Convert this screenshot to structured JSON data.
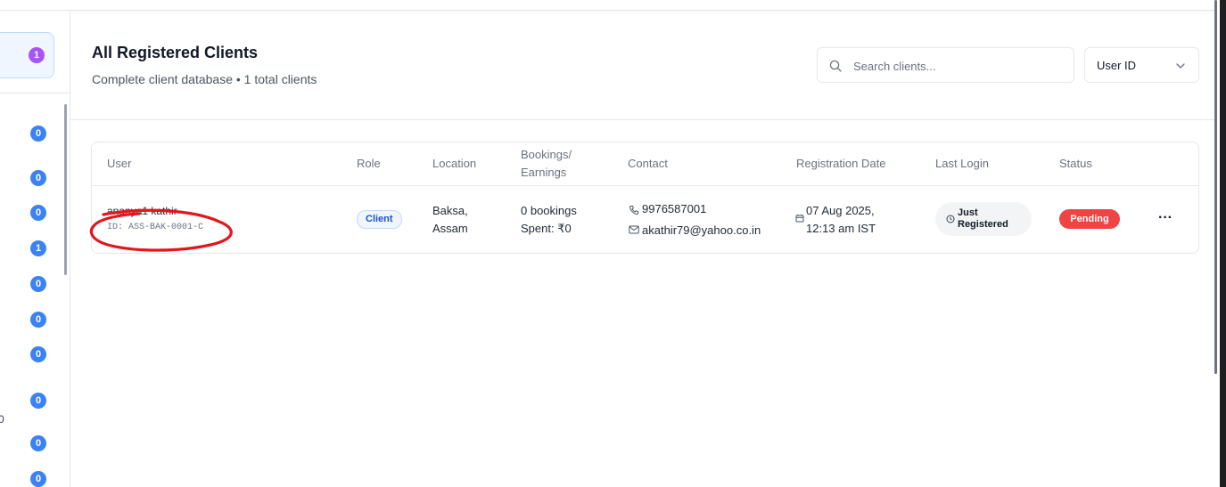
{
  "sidebar": {
    "active_badge": "1",
    "badges": [
      "0",
      "0",
      "0",
      "1",
      "0",
      "0",
      "0",
      "0",
      "0",
      "0"
    ],
    "partial_text": "0"
  },
  "header": {
    "title": "All Registered Clients",
    "subtitle": "Complete client database • 1 total clients"
  },
  "search": {
    "placeholder": "Search clients...",
    "value": ""
  },
  "filter": {
    "selected": "User ID"
  },
  "table": {
    "columns": {
      "user": "User",
      "role": "Role",
      "location": "Location",
      "bookings": [
        "Bookings/",
        "Earnings"
      ],
      "contact": "Contact",
      "registration_date": "Registration Date",
      "last_login": "Last Login",
      "status": "Status"
    },
    "rows": [
      {
        "name": "ananya1 kathir",
        "id": "ID: ASS-BAK-0001-C",
        "role": "Client",
        "location": [
          "Baksa,",
          "Assam"
        ],
        "bookings": "0 bookings",
        "spent": "Spent: ₹0",
        "phone": "9976587001",
        "email": "akathir79@yahoo.co.in",
        "registration": [
          "07 Aug 2025,",
          "12:13 am IST"
        ],
        "last_login": [
          "Just",
          "Registered"
        ],
        "status": "Pending",
        "more": "···"
      }
    ]
  },
  "colors": {
    "accent": "#3b82f6",
    "purple_badge": "#a855f7",
    "status_pending": "#ef4444",
    "annotation": "#e3161b"
  }
}
